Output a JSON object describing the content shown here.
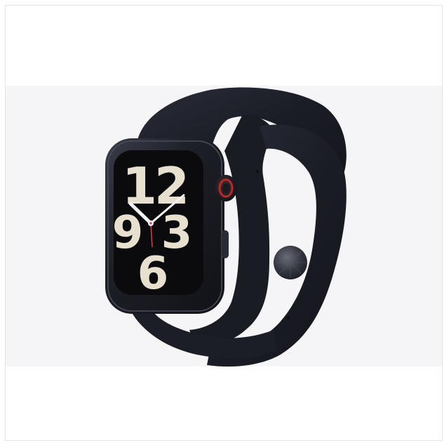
{
  "product": {
    "icon": "smartwatch-product-photo",
    "dial_numerals": [
      "12",
      "3",
      "6",
      "9"
    ],
    "colors": {
      "case": "#1d1f27",
      "band": "#1b1d26",
      "dial_numeral": "#e8e0cf",
      "crown_accent": "#b62a2a",
      "backdrop": "#f5f5f7"
    }
  }
}
